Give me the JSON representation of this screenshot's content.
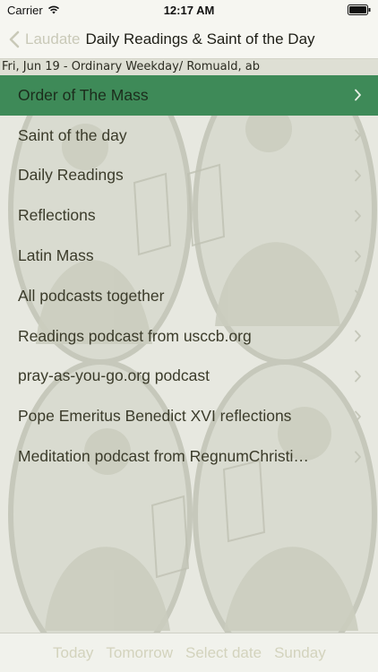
{
  "status": {
    "carrier": "Carrier",
    "time": "12:17 AM"
  },
  "nav": {
    "back_label": "Laudate",
    "title": "Daily Readings & Saint of the Day"
  },
  "date_line": "Fri, Jun 19 - Ordinary Weekday/ Romuald, ab",
  "menu": {
    "items": [
      {
        "label": "Order of The Mass",
        "selected": true
      },
      {
        "label": "Saint of the day"
      },
      {
        "label": "Daily Readings"
      },
      {
        "label": "Reflections"
      },
      {
        "label": "Latin Mass"
      },
      {
        "label": "All podcasts together"
      },
      {
        "label": "Readings podcast from usccb.org"
      },
      {
        "label": "pray-as-you-go.org podcast"
      },
      {
        "label": "Pope Emeritus Benedict XVI reflections"
      },
      {
        "label": "Meditation podcast from RegnumChristi…"
      }
    ]
  },
  "toolbar": {
    "today": "Today",
    "tomorrow": "Tomorrow",
    "select_date": "Select date",
    "sunday": "Sunday"
  },
  "colors": {
    "selected_row": "#3e8a58",
    "toolbar_text": "#d3d3bd",
    "back_text": "#c9c9b8"
  }
}
